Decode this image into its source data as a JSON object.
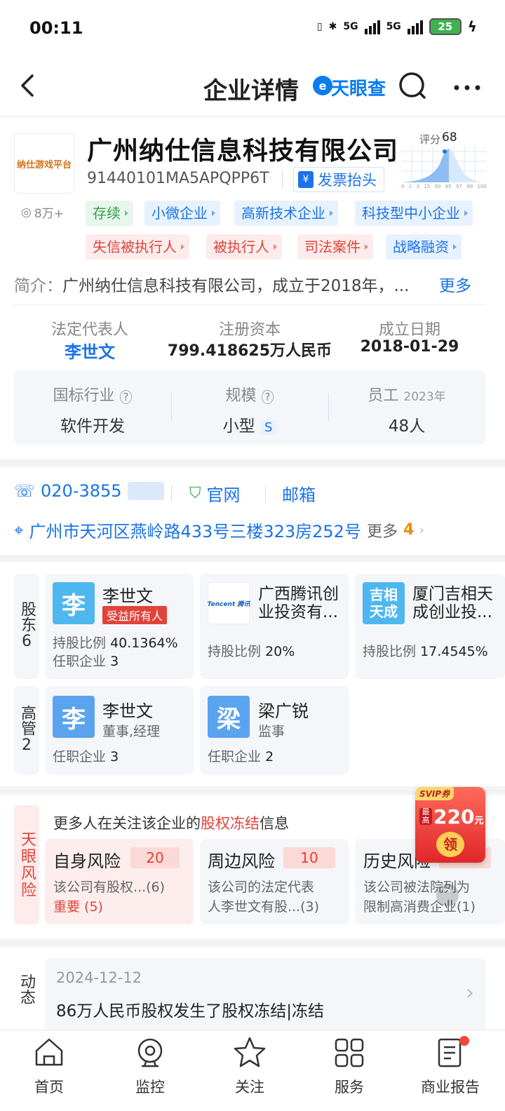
{
  "status_bar": {
    "time": "00:11",
    "net1": "5G",
    "net2": "5G",
    "battery": "25"
  },
  "nav": {
    "title": "企业详情",
    "brand": "天眼查"
  },
  "company": {
    "logo_text": "纳仕游戏平台",
    "name": "广州纳仕信息科技有限公司",
    "credit_code": "91440101MA5APQPP6T",
    "invoice_label": "发票抬头",
    "views": "8万+",
    "score_label": "评分",
    "score": "68",
    "score_ticks": [
      "0",
      "1",
      "3",
      "15",
      "50",
      "85",
      "97",
      "99",
      "100"
    ],
    "tags_row1": [
      "存续",
      "小微企业",
      "高新技术企业",
      "科技型中小企业"
    ],
    "tags_row2": [
      "失信被执行人",
      "被执行人",
      "司法案件",
      "战略融资"
    ],
    "intro_label": "简介：",
    "intro_text": "广州纳仕信息科技有限公司，成立于2018年，...",
    "more_label": "更多"
  },
  "basic": {
    "legal_rep_label": "法定代表人",
    "legal_rep": "李世文",
    "capital_label": "注册资本",
    "capital": "799.418625万人民币",
    "date_label": "成立日期",
    "date": "2018-01-29",
    "industry_label": "国标行业",
    "industry": "软件开发",
    "scale_label": "规模",
    "scale": "小型",
    "scale_badge": "S",
    "staff_label": "员工",
    "staff_year": "2023年",
    "staff": "48人"
  },
  "contact": {
    "phone": "020-3855",
    "website": "官网",
    "email": "邮箱",
    "address": "广州市天河区燕岭路433号三楼323房252号",
    "more_label": "更多",
    "more_count": "4"
  },
  "shareholders": {
    "side_label": "股东",
    "count": "6",
    "items": [
      {
        "avatar": "李",
        "name": "李世文",
        "badge": "受益所有人",
        "ratio_label": "持股比例",
        "ratio": "40.1364%",
        "pos_label": "任职企业",
        "pos": "3"
      },
      {
        "avatar": "Tencent 腾讯",
        "name": "广西腾讯创业投资有...",
        "ratio_label": "持股比例",
        "ratio": "20%"
      },
      {
        "avatar": "吉相天成",
        "name": "厦门吉相天成创业投...",
        "ratio_label": "持股比例",
        "ratio": "17.4545%"
      }
    ]
  },
  "executives": {
    "side_label": "高管",
    "count": "2",
    "items": [
      {
        "avatar": "李",
        "name": "李世文",
        "role": "董事,经理",
        "pos_label": "任职企业",
        "pos": "3"
      },
      {
        "avatar": "梁",
        "name": "梁广锐",
        "role": "监事",
        "pos_label": "任职企业",
        "pos": "2"
      }
    ]
  },
  "risk": {
    "side_label": "天眼风险",
    "header_prefix": "更多人在关注该企业的",
    "header_highlight": "股权冻结",
    "header_suffix": "信息",
    "items": [
      {
        "title": "自身风险",
        "count": "20",
        "desc": "该公司有股权...(6)",
        "important": "重要 (5)"
      },
      {
        "title": "周边风险",
        "count": "10",
        "desc1": "该公司的法定代表",
        "desc2": "人李世文有股...(3)"
      },
      {
        "title": "历史风险",
        "desc1": "该公司被法院列为",
        "desc2": "限制高消费企业(1)"
      }
    ],
    "promo": {
      "tag": "SVIP券",
      "top": "最高",
      "amount": "220",
      "unit": "元",
      "btn": "领"
    }
  },
  "news": {
    "side_label": "动态",
    "date": "2024-12-12",
    "text": "86万人民币股权发生了股权冻结|冻结"
  },
  "tabbar": {
    "items": [
      "首页",
      "监控",
      "关注",
      "服务",
      "商业报告"
    ]
  },
  "colors": {
    "accent": "#1a73e8",
    "danger": "#e0433a",
    "success": "#2ea24a",
    "orange": "#f08c00"
  }
}
